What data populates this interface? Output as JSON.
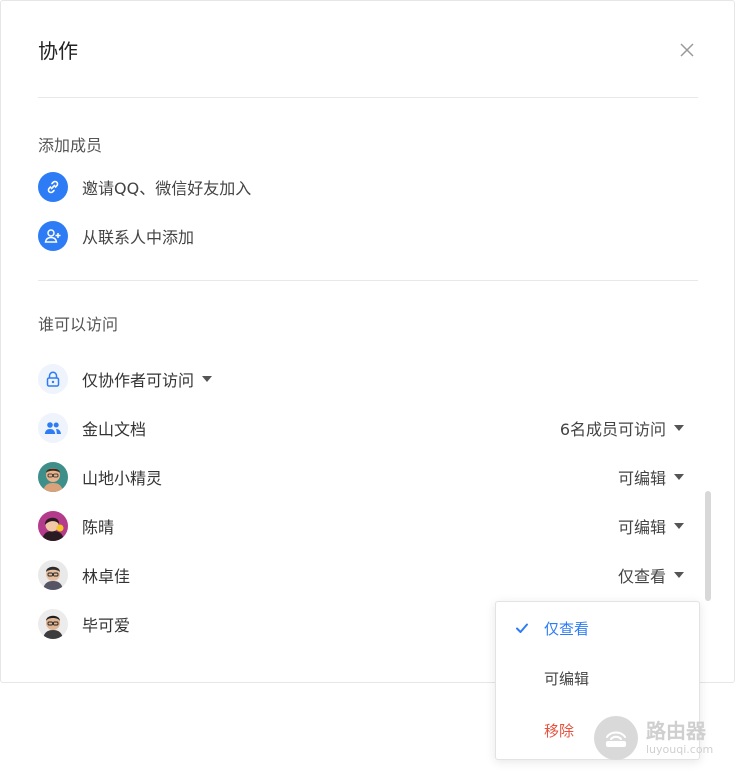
{
  "dialog": {
    "title": "协作",
    "add_section": {
      "label": "添加成员",
      "invite_label": "邀请QQ、微信好友加入",
      "contacts_label": "从联系人中添加"
    },
    "access_section": {
      "label": "谁可以访问",
      "visibility": "仅协作者可访问",
      "org": {
        "name": "金山文档",
        "permission": "6名成员可访问"
      },
      "members": [
        {
          "name": "山地小精灵",
          "permission": "可编辑"
        },
        {
          "name": "陈晴",
          "permission": "可编辑"
        },
        {
          "name": "林卓佳",
          "permission": "仅查看"
        },
        {
          "name": "毕可爱",
          "permission": ""
        }
      ]
    }
  },
  "permission_menu": {
    "options": [
      {
        "label": "仅查看",
        "selected": true
      },
      {
        "label": "可编辑",
        "selected": false
      },
      {
        "label": "移除",
        "selected": false,
        "danger": true
      }
    ]
  },
  "watermark": {
    "text": "路由器",
    "subtext": "luyouqi.com"
  },
  "colors": {
    "accent": "#2d7cf6",
    "danger": "#e5523f",
    "text": "#333333",
    "divider": "#e8e8e8"
  }
}
